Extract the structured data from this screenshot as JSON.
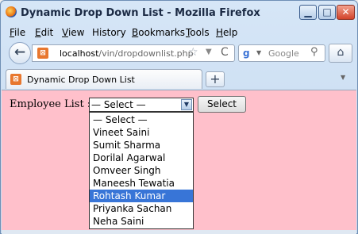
{
  "window": {
    "title": "Dynamic Drop Down List - Mozilla Firefox",
    "controls": {
      "minimize": "▁",
      "maximize": "□",
      "close": "✕"
    }
  },
  "menu": {
    "items": [
      "File",
      "Edit",
      "View",
      "History",
      "Bookmarks",
      "Tools",
      "Help"
    ],
    "access_keys": [
      "F",
      "E",
      "V",
      "S",
      "B",
      "T",
      "H"
    ]
  },
  "navbar": {
    "url_host": "localhost",
    "url_path": "/vin/dropdownlist.php",
    "search_placeholder": "Google",
    "back_glyph": "←",
    "reload_glyph": "C",
    "home_glyph": "⌂"
  },
  "tab": {
    "label": "Dynamic Drop Down List",
    "new_tab_glyph": "+"
  },
  "page": {
    "label": "Employee List :",
    "select_value": "— Select —",
    "button_label": "Select",
    "options": [
      "— Select —",
      "Vineet Saini",
      "Sumit Sharma",
      "Dorilal Agarwal",
      "Omveer Singh",
      "Maneesh Tewatia",
      "Rohtash Kumar",
      "Priyanka Sachan",
      "Neha Saini"
    ],
    "highlighted_option": "Rohtash Kumar"
  },
  "colors": {
    "page_background": "#ffc0cb",
    "highlight": "#3875d7",
    "close_button": "#d2432a"
  }
}
